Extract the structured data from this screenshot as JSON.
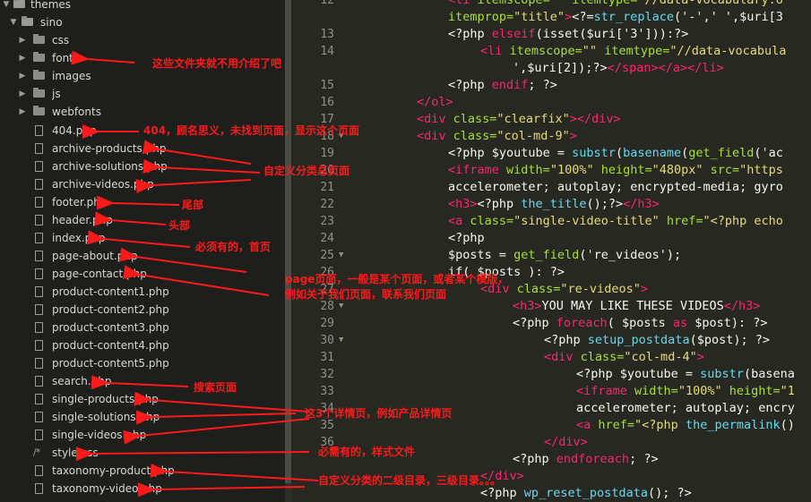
{
  "sidebar": {
    "root_items": [
      {
        "label": "themes",
        "type": "folder-open"
      },
      {
        "label": "sino",
        "type": "folder-open"
      }
    ],
    "folders": [
      "css",
      "fonts",
      "images",
      "js",
      "webfonts"
    ],
    "files": [
      {
        "label": "404.php",
        "icon": "file-icon"
      },
      {
        "label": "archive-products.php",
        "icon": "file-icon"
      },
      {
        "label": "archive-solutions.php",
        "icon": "file-icon"
      },
      {
        "label": "archive-videos.php",
        "icon": "file-icon"
      },
      {
        "label": "footer.php",
        "icon": "file-icon"
      },
      {
        "label": "header.php",
        "icon": "file-icon"
      },
      {
        "label": "index.php",
        "icon": "file-icon"
      },
      {
        "label": "page-about.php",
        "icon": "file-icon"
      },
      {
        "label": "page-contact.php",
        "icon": "file-icon"
      },
      {
        "label": "product-content1.php",
        "icon": "file-icon"
      },
      {
        "label": "product-content2.php",
        "icon": "file-icon"
      },
      {
        "label": "product-content3.php",
        "icon": "file-icon"
      },
      {
        "label": "product-content4.php",
        "icon": "file-icon"
      },
      {
        "label": "product-content5.php",
        "icon": "file-icon"
      },
      {
        "label": "search.php",
        "icon": "file-icon"
      },
      {
        "label": "single-products.php",
        "icon": "file-icon"
      },
      {
        "label": "single-solutions.php",
        "icon": "file-icon"
      },
      {
        "label": "single-videos.php",
        "icon": "file-icon"
      },
      {
        "label": "style.css",
        "icon": "css-file-icon"
      },
      {
        "label": "taxonomy-product.php",
        "icon": "file-icon"
      },
      {
        "label": "taxonomy-video.php",
        "icon": "file-icon"
      }
    ]
  },
  "annotations": {
    "folders_note": "这些文件夹就不用介绍了吧",
    "notfound_note": "404，顾名思义，未找到页面，显示这个页面",
    "archive_note": "自定义分类总页面",
    "footer_note": "尾部",
    "header_note": "头部",
    "index_note": "必须有的，首页",
    "page_note_1": "page页面，一般是某个页面，或者某个模版，",
    "page_note_2": "例如关于我们页面，联系我们页面",
    "search_note": "搜索页面",
    "single_note": "这3个详情页，例如产品详情页",
    "style_note": "必需有的，样式文件",
    "taxonomy_note": "自定义分类的二级目录，三级目录。。。",
    "color": "#ff1a1a"
  },
  "editor": {
    "line_numbers": [
      "12",
      "13",
      "14",
      "15",
      "16",
      "17",
      "18",
      "19",
      "20",
      "21",
      "22",
      "23",
      "24",
      "25",
      "26",
      "27",
      "28",
      "29",
      "30",
      "31",
      "32",
      "33",
      "34",
      "35",
      "36"
    ],
    "lines": [
      [
        [
          "<li ",
          "t-tag"
        ],
        [
          "itemscope=",
          "t-attr"
        ],
        [
          "\"\" ",
          "t-str"
        ],
        [
          "itemtype=",
          "t-attr"
        ],
        [
          "\"//data-vocabulary.o",
          "t-str"
        ]
      ],
      [
        [
          "itemprop=",
          "t-attr"
        ],
        [
          "\"title\"",
          "t-str"
        ],
        [
          ">",
          "t-tag"
        ],
        [
          "<?=",
          "t-pl"
        ],
        [
          "str_replace",
          "t-fn"
        ],
        [
          "('-',' ',$uri[3",
          "t-pl"
        ]
      ],
      [
        [
          "<?php ",
          "t-pl"
        ],
        [
          "elseif",
          "t-kw"
        ],
        [
          "(isset($uri['3'])):?>",
          "t-pl"
        ]
      ],
      [
        [
          "<li ",
          "t-tag"
        ],
        [
          "itemscope=",
          "t-attr"
        ],
        [
          "\"\" ",
          "t-str"
        ],
        [
          "itemtype=",
          "t-attr"
        ],
        [
          "\"//data-vocabula",
          "t-str"
        ]
      ],
      [
        [
          "',$uri[2]);?>",
          "t-pl"
        ],
        [
          "</",
          "t-tag"
        ],
        [
          "span",
          "t-tag"
        ],
        [
          "></",
          "t-tag"
        ],
        [
          "a",
          "t-tag"
        ],
        [
          "></",
          "t-tag"
        ],
        [
          "li",
          "t-tag"
        ],
        [
          ">",
          "t-tag"
        ]
      ],
      [
        [
          "<?php ",
          "t-pl"
        ],
        [
          "endif",
          "t-kw"
        ],
        [
          "; ?>",
          "t-pl"
        ]
      ],
      [
        [
          "</",
          "t-tag"
        ],
        [
          "ol",
          "t-tag"
        ],
        [
          ">",
          "t-tag"
        ]
      ],
      [
        [
          "<div ",
          "t-tag"
        ],
        [
          "class=",
          "t-attr"
        ],
        [
          "\"clearfix\"",
          "t-str"
        ],
        [
          "></",
          "t-tag"
        ],
        [
          "div",
          "t-tag"
        ],
        [
          ">",
          "t-tag"
        ]
      ],
      [
        [
          "<div ",
          "t-tag"
        ],
        [
          "class=",
          "t-attr"
        ],
        [
          "\"col-md-9\"",
          "t-str"
        ],
        [
          ">",
          "t-tag"
        ]
      ],
      [
        [
          "<?php $youtube = ",
          "t-pl"
        ],
        [
          "substr",
          "t-fn"
        ],
        [
          "(",
          "t-pl"
        ],
        [
          "basename",
          "t-fn"
        ],
        [
          "(",
          "t-pl"
        ],
        [
          "get_field",
          "t-attr"
        ],
        [
          "('ac",
          "t-pl"
        ]
      ],
      [
        [
          "<iframe ",
          "t-tag"
        ],
        [
          "width=",
          "t-attr"
        ],
        [
          "\"100%\" ",
          "t-str"
        ],
        [
          "height=",
          "t-attr"
        ],
        [
          "\"480px\" ",
          "t-str"
        ],
        [
          "src=",
          "t-attr"
        ],
        [
          "\"https",
          "t-str"
        ]
      ],
      [
        [
          "accelerometer; autoplay; encrypted-media; gyro",
          "t-pl"
        ]
      ],
      [
        [
          "<h3>",
          "t-tag"
        ],
        [
          "<?php ",
          "t-pl"
        ],
        [
          "the_title",
          "t-fn"
        ],
        [
          "();?>",
          "t-pl"
        ],
        [
          "</h3>",
          "t-tag"
        ]
      ],
      [
        [
          "<a ",
          "t-tag"
        ],
        [
          "class=",
          "t-attr"
        ],
        [
          "\"single-video-title\" ",
          "t-str"
        ],
        [
          "href=",
          "t-attr"
        ],
        [
          "\"<?php echo",
          "t-str"
        ]
      ],
      [
        [
          "<?php",
          "t-pl"
        ]
      ],
      [
        [
          "$posts = ",
          "t-pl"
        ],
        [
          "get_field",
          "t-attr"
        ],
        [
          "('re_videos');",
          "t-pl"
        ]
      ],
      [
        [
          "if( $posts ): ?>",
          "t-pl"
        ]
      ],
      [
        [
          "<div ",
          "t-tag"
        ],
        [
          "class=",
          "t-attr"
        ],
        [
          "\"re-videos\"",
          "t-str"
        ],
        [
          ">",
          "t-tag"
        ]
      ],
      [
        [
          "<h3>",
          "t-tag"
        ],
        [
          "YOU MAY LIKE THESE VIDEOS",
          "t-pl"
        ],
        [
          "</h3>",
          "t-tag"
        ]
      ],
      [
        [
          "<?php ",
          "t-pl"
        ],
        [
          "foreach",
          "t-kw"
        ],
        [
          "( $posts ",
          "t-pl"
        ],
        [
          "as",
          "t-kw"
        ],
        [
          " $post): ?>",
          "t-pl"
        ]
      ],
      [
        [
          "<?php ",
          "t-pl"
        ],
        [
          "setup_postdata",
          "t-fn"
        ],
        [
          "($post); ?>",
          "t-pl"
        ]
      ],
      [
        [
          "<div ",
          "t-tag"
        ],
        [
          "class=",
          "t-attr"
        ],
        [
          "\"col-md-4\"",
          "t-str"
        ],
        [
          ">",
          "t-tag"
        ]
      ],
      [
        [
          "<?php $youtube = ",
          "t-pl"
        ],
        [
          "substr",
          "t-fn"
        ],
        [
          "(basena",
          "t-pl"
        ]
      ],
      [
        [
          "<iframe ",
          "t-tag"
        ],
        [
          "width=",
          "t-attr"
        ],
        [
          "\"100%\" ",
          "t-str"
        ],
        [
          "height=",
          "t-attr"
        ],
        [
          "\"1",
          "t-str"
        ]
      ],
      [
        [
          "accelerometer; autoplay; encry",
          "t-pl"
        ]
      ],
      [
        [
          "<a ",
          "t-tag"
        ],
        [
          "href=",
          "t-attr"
        ],
        [
          "\"<?php ",
          "t-str"
        ],
        [
          "the_permalink",
          "t-fn"
        ],
        [
          "()",
          "t-pl"
        ]
      ],
      [
        [
          "</div>",
          "t-tag"
        ]
      ],
      [
        [
          "<?php ",
          "t-pl"
        ],
        [
          "endforeach",
          "t-kw"
        ],
        [
          "; ?>",
          "t-pl"
        ]
      ],
      [
        [
          "</div>",
          "t-tag"
        ]
      ],
      [
        [
          "<?php ",
          "t-pl"
        ],
        [
          "wp_reset_postdata",
          "t-fn"
        ],
        [
          "(); ?>",
          "t-pl"
        ]
      ]
    ]
  }
}
